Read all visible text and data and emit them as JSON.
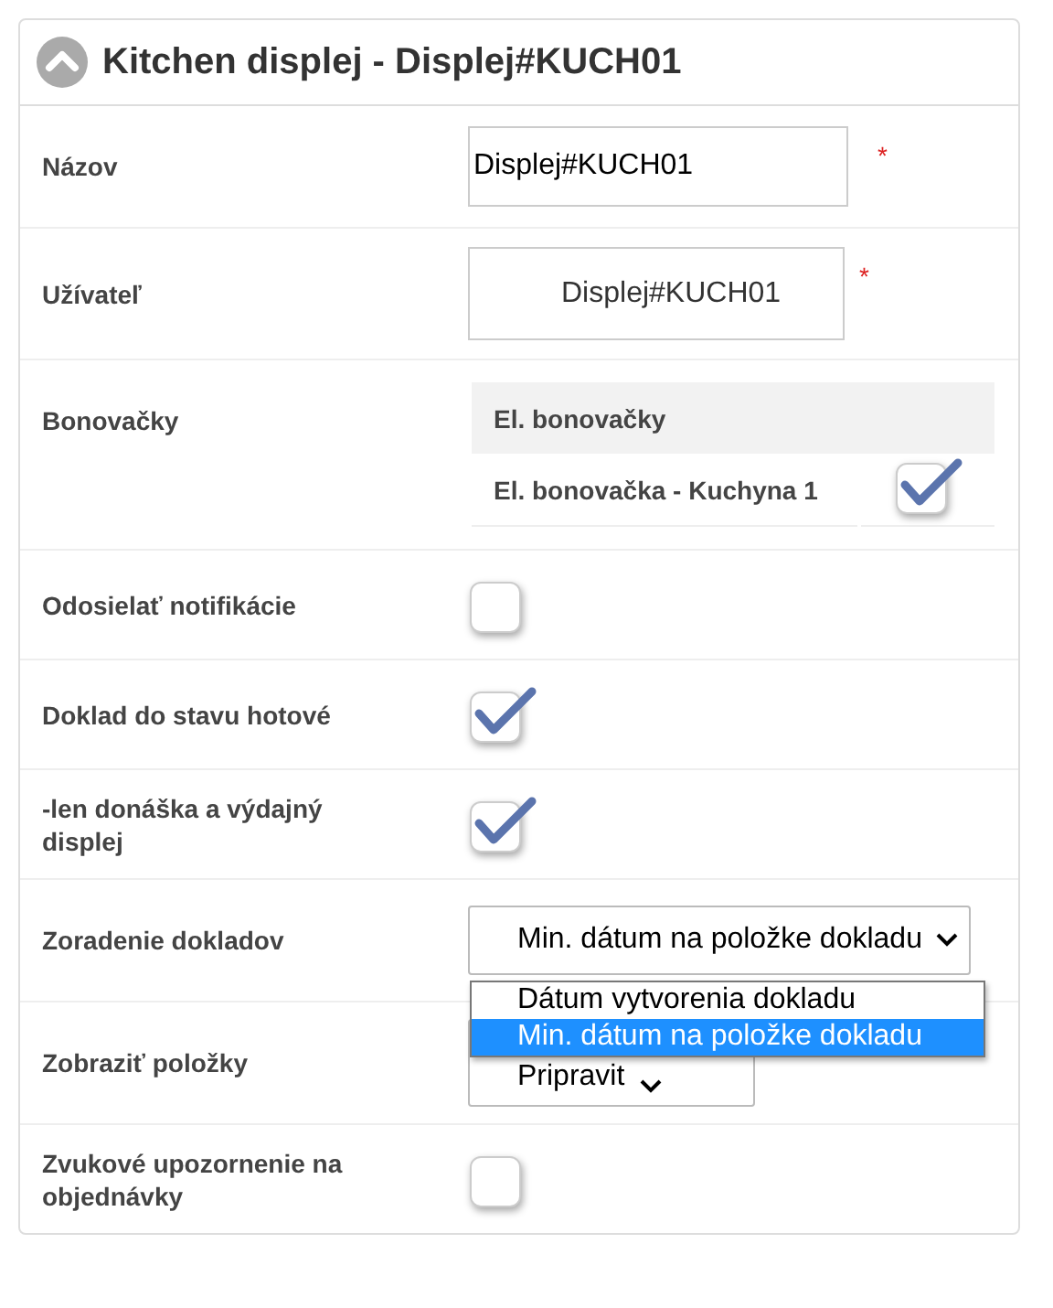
{
  "panel": {
    "title": "Kitchen displej - Displej#KUCH01",
    "expanded": true
  },
  "rows": [
    {
      "kind": "text",
      "label": "Názov",
      "value": "Displej#KUCH01",
      "required_mark": "*"
    },
    {
      "kind": "user",
      "label": "Užívateľ",
      "value": "Displej#KUCH01",
      "required_mark": "*"
    },
    {
      "kind": "table",
      "label": "Bonovačky",
      "table": {
        "header": "El. bonovačky",
        "rows": [
          {
            "name": "El. bonovačka - Kuchyna 1",
            "checked": true
          }
        ]
      }
    },
    {
      "kind": "checkbox",
      "label": "Odosielať notifikácie",
      "checked": false
    },
    {
      "kind": "checkbox",
      "label": "Doklad do stavu hotové",
      "checked": true
    },
    {
      "kind": "checkbox",
      "label": "-len donáška a výdajný displej",
      "checked": true
    },
    {
      "kind": "select",
      "label": "Zoradenie dokladov",
      "value": "Min. dátum na položke dokladu",
      "open": true,
      "options": [
        {
          "label": "Dátum vytvorenia dokladu",
          "selected": false
        },
        {
          "label": "Min. dátum na položke dokladu",
          "selected": true
        }
      ]
    },
    {
      "kind": "select",
      "label": "Zobraziť položky",
      "value": "Pripravit",
      "open": false
    },
    {
      "kind": "checkbox",
      "label": "Zvukové upozornenie na objednávky",
      "checked": false
    }
  ]
}
